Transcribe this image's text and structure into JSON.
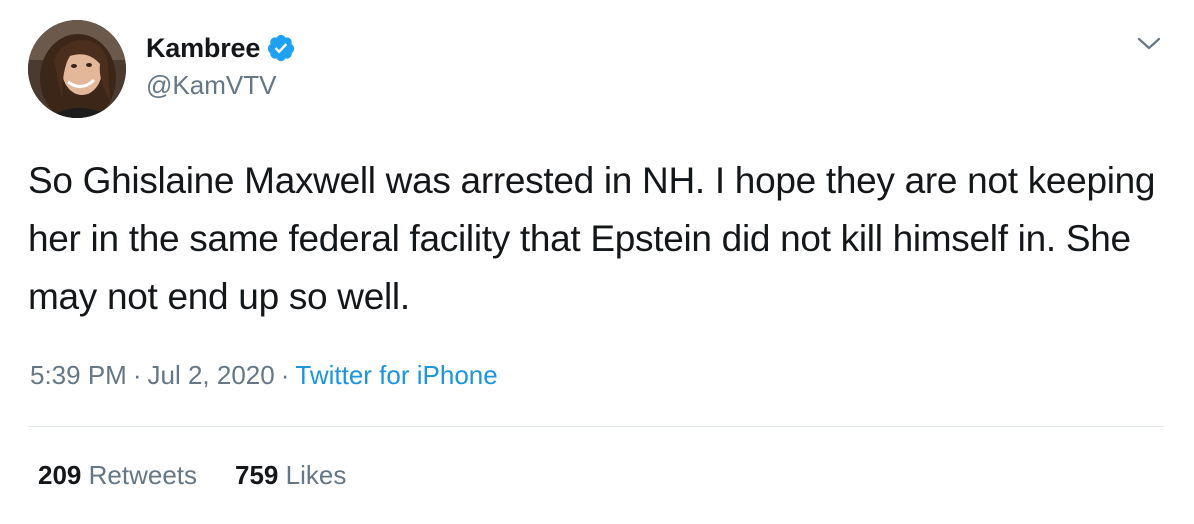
{
  "author": {
    "display_name": "Kambree",
    "handle": "@KamVTV",
    "verified": true,
    "avatar_icon": "profile-photo"
  },
  "tweet": {
    "text": "So Ghislaine Maxwell was arrested in NH. I hope they are not keeping her in the same federal facility that Epstein did not kill himself in. She may not end up so well.",
    "time": "5:39 PM",
    "separator": "·",
    "date": "Jul 2, 2020",
    "source": "Twitter for iPhone"
  },
  "stats": {
    "retweets_count": "209",
    "retweets_label": "Retweets",
    "likes_count": "759",
    "likes_label": "Likes"
  },
  "icons": {
    "verified": "verified-badge-icon",
    "menu": "chevron-down-icon"
  },
  "colors": {
    "primary_text": "#14171a",
    "secondary_text": "#657786",
    "link": "#1b95e0",
    "verified_badge": "#1da1f2",
    "divider": "#e1e8ed"
  }
}
